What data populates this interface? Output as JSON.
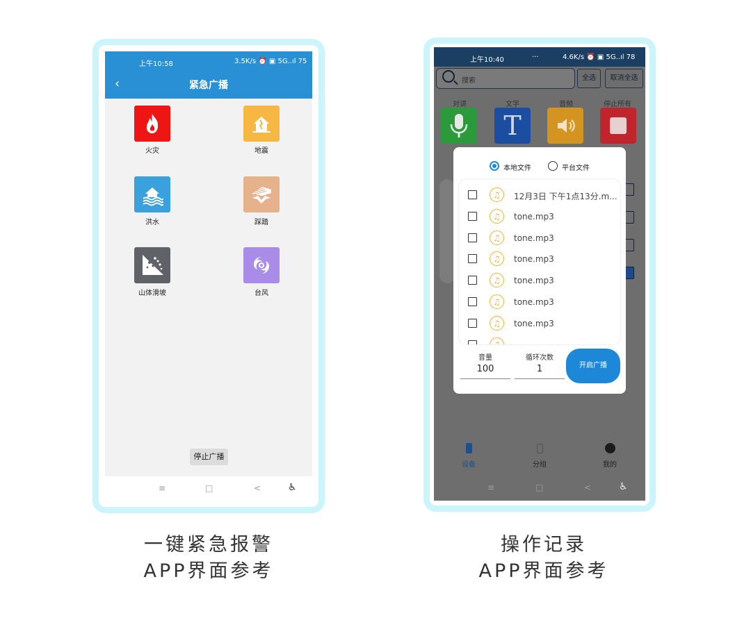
{
  "phone_a": {
    "status": {
      "time": "上午10:58",
      "right": "3.5K/s ⏰ ▣ 5G..ıl 75"
    },
    "title": "紧急广播",
    "tiles": [
      {
        "label": "火灾",
        "color": "#ee1515",
        "icon": "fire-icon"
      },
      {
        "label": "地震",
        "color": "#f7b843",
        "icon": "earthquake-house-icon"
      },
      {
        "label": "洪水",
        "color": "#3ba1dc",
        "icon": "flood-house-icon"
      },
      {
        "label": "踩踏",
        "color": "#e6b28c",
        "icon": "stampede-icon"
      },
      {
        "label": "山体滑坡",
        "color": "#5f6266",
        "icon": "landslide-icon"
      },
      {
        "label": "台风",
        "color": "#a98ce8",
        "icon": "typhoon-icon"
      }
    ],
    "stop_button": "停止广播",
    "nav": {
      "menu": "≡",
      "home": "□",
      "back": "<",
      "accessibility": "♿"
    }
  },
  "phone_b": {
    "status": {
      "time": "上午10:40",
      "right": "4.6K/s ⏰ ▣ 5G..ıl 78",
      "dots": "···"
    },
    "search_placeholder": "搜索",
    "select_all": "全选",
    "deselect_all": "取消全选",
    "actions": [
      {
        "label": "对讲",
        "color": "#2b9a3b",
        "icon": "microphone-icon"
      },
      {
        "label": "文字",
        "color": "#1b4ea0",
        "icon": "text-T-icon"
      },
      {
        "label": "音频",
        "color": "#d49520",
        "icon": "speaker-icon"
      },
      {
        "label": "停止所有",
        "color": "#c0242c",
        "icon": "stop-icon"
      }
    ],
    "dialog": {
      "radio_local": "本地文件",
      "radio_platform": "平台文件",
      "files": [
        "12月3日 下午1点13分.m...",
        "tone.mp3",
        "tone.mp3",
        "tone.mp3",
        "tone.mp3",
        "tone.mp3",
        "tone.mp3"
      ],
      "volume_label": "音量",
      "volume_value": "100",
      "loop_label": "循环次数",
      "loop_value": "1",
      "start_button": "开启广播"
    },
    "tabs": [
      {
        "label": "设备",
        "icon": "device-icon"
      },
      {
        "label": "分组",
        "icon": "group-icon"
      },
      {
        "label": "我的",
        "icon": "profile-icon"
      }
    ],
    "nav": {
      "menu": "≡",
      "home": "□",
      "back": "<",
      "accessibility": "♿"
    }
  },
  "captions": {
    "left_line1": "一键紧急报警",
    "left_line2": "APP界面参考",
    "right_line1": "操作记录",
    "right_line2": "APP界面参考"
  }
}
